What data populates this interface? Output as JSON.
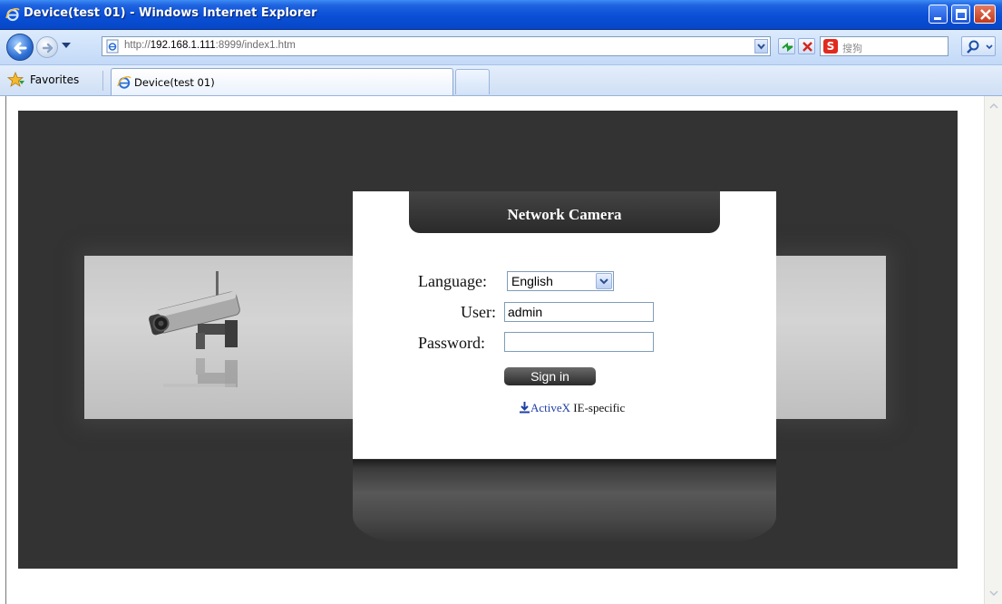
{
  "window": {
    "title": "Device(test 01) - Windows Internet Explorer"
  },
  "address_bar": {
    "url_prefix": "http://",
    "url_host": "192.168.1.111",
    "url_suffix": ":8999/index1.htm",
    "search_logo": "S",
    "search_placeholder": "搜狗"
  },
  "favorites_bar": {
    "favorites_label": "Favorites",
    "tabs": [
      {
        "label": "Device(test 01)"
      }
    ]
  },
  "page": {
    "header_title": "Network Camera",
    "language_label": "Language:",
    "language_value": "English",
    "user_label": "User:",
    "user_value": "admin",
    "password_label": "Password:",
    "password_value": "",
    "signin_label": "Sign in",
    "activex_link": "ActiveX",
    "activex_note": " IE-specific"
  },
  "colors": {
    "titlebar": "#0a4fd6",
    "stage_background": "#333333",
    "login_header": "#2a2a2a",
    "link": "#1f3fa5"
  },
  "icons": [
    "ie-logo-icon",
    "minimize-icon",
    "maximize-icon",
    "close-icon",
    "back-arrow-icon",
    "forward-arrow-icon",
    "page-icon",
    "refresh-icon",
    "stop-icon",
    "sogou-icon",
    "search-icon",
    "favorites-star-icon",
    "download-icon",
    "scroll-up-icon",
    "scroll-down-icon"
  ]
}
